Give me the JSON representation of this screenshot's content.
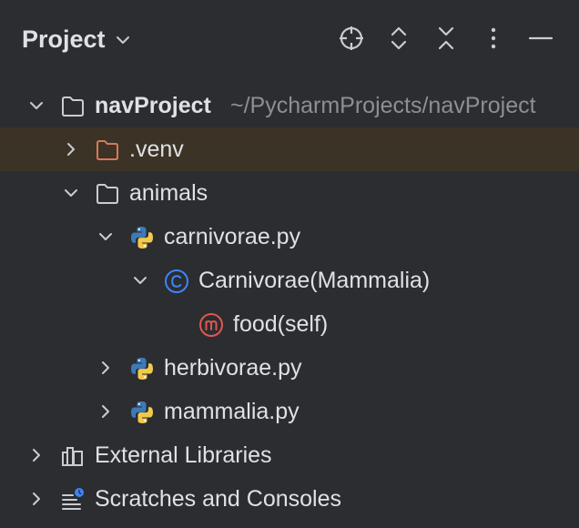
{
  "header": {
    "title": "Project",
    "buttons": [
      {
        "icon": "locate-icon"
      },
      {
        "icon": "expand-all-icon"
      },
      {
        "icon": "collapse-all-icon"
      },
      {
        "icon": "more-options-icon"
      },
      {
        "icon": "hide-icon"
      }
    ]
  },
  "tree": {
    "root": {
      "label": "navProject",
      "path": "~/PycharmProjects/navProject"
    },
    "venv": {
      "label": ".venv"
    },
    "animals": {
      "label": "animals"
    },
    "carnivorae_file": {
      "label": "carnivorae.py"
    },
    "carnivorae_class": {
      "label": "Carnivorae(Mammalia)"
    },
    "food_method": {
      "label": "food(self)"
    },
    "herbivorae_file": {
      "label": "herbivorae.py"
    },
    "mammalia_file": {
      "label": "mammalia.py"
    },
    "external_libraries": {
      "label": "External Libraries"
    },
    "scratches": {
      "label": "Scratches and Consoles"
    }
  },
  "colors": {
    "background": "#2b2d30",
    "selection": "#2e436e",
    "excluded_row": "#3b3326",
    "text": "#dfe1e5",
    "path_text": "#8c8f94",
    "venv_folder": "#d97757",
    "class_icon": "#3f83f8",
    "method_icon": "#e0574f"
  }
}
